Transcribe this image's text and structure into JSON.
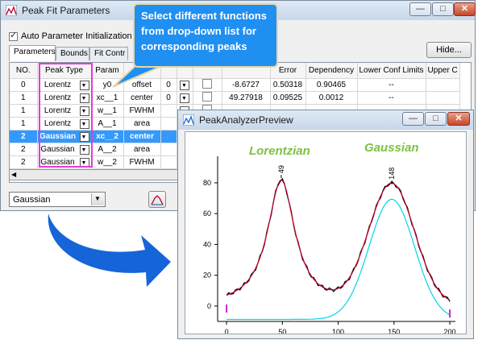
{
  "main_window": {
    "title": "Peak Fit Parameters",
    "auto_param_label": "Auto Parameter Initialization",
    "auto_param_checked": true,
    "hide_button": "Hide...",
    "tabs": [
      "Parameters",
      "Bounds",
      "Fit Contr"
    ],
    "columns": [
      "NO.",
      "Peak Type",
      "Param",
      "M",
      "",
      "",
      "",
      "Error",
      "Dependency",
      "Lower Conf Limits",
      "Upper C"
    ],
    "rows": [
      {
        "no": "0",
        "type": "Lorentz",
        "param": "y0",
        "meaning": "offset",
        "fix": "0",
        "value": "-8.6727",
        "error": "0.50318",
        "dep": "0.90465",
        "lcl": "--",
        "selected": false
      },
      {
        "no": "1",
        "type": "Lorentz",
        "param": "xc__1",
        "meaning": "center",
        "fix": "0",
        "value": "49.27918",
        "error": "0.09525",
        "dep": "0.0012",
        "lcl": "--",
        "selected": false
      },
      {
        "no": "1",
        "type": "Lorentz",
        "param": "w__1",
        "meaning": "FWHM",
        "fix": "",
        "value": "",
        "error": "",
        "dep": "",
        "lcl": "",
        "selected": false
      },
      {
        "no": "1",
        "type": "Lorentz",
        "param": "A__1",
        "meaning": "area",
        "fix": "",
        "value": "",
        "error": "",
        "dep": "",
        "lcl": "",
        "selected": false
      },
      {
        "no": "2",
        "type": "Gaussian",
        "param": "xc__2",
        "meaning": "center",
        "fix": "",
        "value": "",
        "error": "",
        "dep": "",
        "lcl": "",
        "selected": true
      },
      {
        "no": "2",
        "type": "Gaussian",
        "param": "A__2",
        "meaning": "area",
        "fix": "",
        "value": "",
        "error": "",
        "dep": "",
        "lcl": "",
        "selected": false
      },
      {
        "no": "2",
        "type": "Gaussian",
        "param": "w__2",
        "meaning": "FWHM",
        "fix": "",
        "value": "",
        "error": "",
        "dep": "",
        "lcl": "",
        "selected": false
      }
    ],
    "combo_value": "Gaussian"
  },
  "callout": {
    "text": "Select different functions from drop-down list for corresponding peaks"
  },
  "preview_window": {
    "title": "PeakAnalyzerPreview",
    "labels": {
      "lorentzian": "Lorentzian",
      "gaussian": "Gaussian"
    },
    "peak_labels": [
      "49",
      "148"
    ],
    "x_ticks": [
      "0",
      "50",
      "100",
      "150",
      "200"
    ],
    "y_ticks": [
      "0",
      "20",
      "40",
      "60",
      "80"
    ],
    "xlim": [
      0,
      200
    ],
    "ylim": [
      -10,
      90
    ]
  },
  "colors": {
    "callout_bg": "#1f8ff2",
    "highlight_magenta": "#e23cd6",
    "selection_blue": "#3399ff",
    "label_green": "#7cc242",
    "fit_red": "#c0002a",
    "baseline_cyan": "#00d6e8",
    "arrow_blue": "#1565d8"
  },
  "chart_data": {
    "type": "line",
    "x_ticks": [
      0,
      50,
      100,
      150,
      200
    ],
    "y_ticks": [
      0,
      20,
      40,
      60,
      80
    ],
    "xlim": [
      -8,
      205
    ],
    "ylim": [
      -10,
      92
    ],
    "peaks": [
      {
        "name": "Lorentzian",
        "center": 49,
        "height": 82,
        "fwhm": 30
      },
      {
        "name": "Gaussian",
        "center": 148,
        "height": 78,
        "fwhm": 48
      }
    ],
    "offset": -8.6727
  }
}
